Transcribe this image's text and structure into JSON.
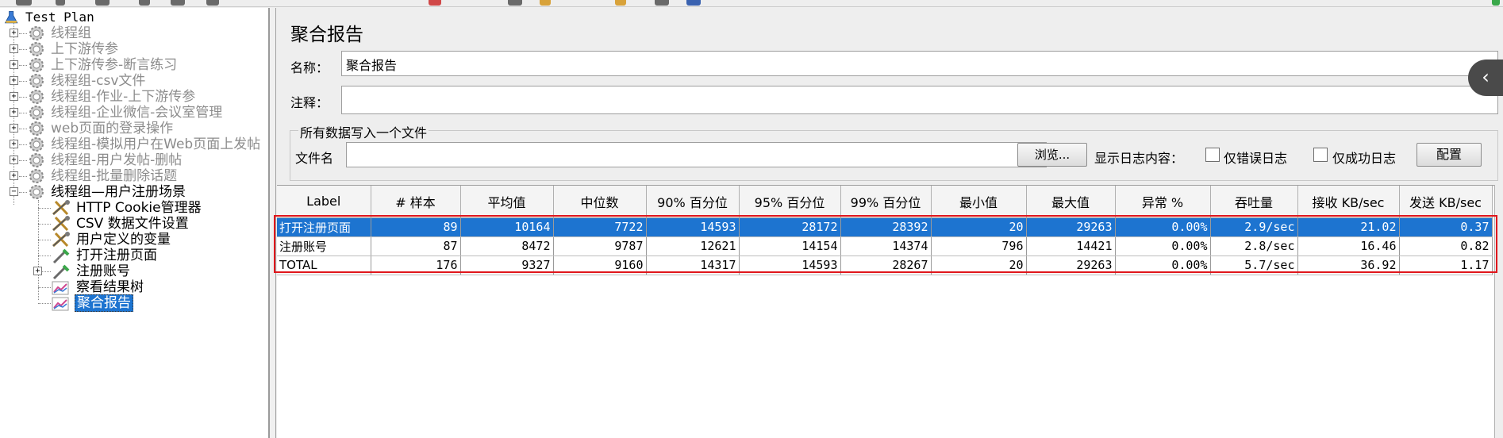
{
  "tree": {
    "root_label": "Test Plan",
    "items": [
      {
        "label": "线程组",
        "disabled": true
      },
      {
        "label": "上下游传参",
        "disabled": true
      },
      {
        "label": "上下游传参-断言练习",
        "disabled": true
      },
      {
        "label": "线程组-csv文件",
        "disabled": true
      },
      {
        "label": "线程组-作业-上下游传参",
        "disabled": true
      },
      {
        "label": "线程组-企业微信-会议室管理",
        "disabled": true
      },
      {
        "label": "web页面的登录操作",
        "disabled": true
      },
      {
        "label": "线程组-模拟用户在Web页面上发帖",
        "disabled": true
      },
      {
        "label": "线程组-用户发帖-删帖",
        "disabled": true
      },
      {
        "label": "线程组-批量删除话题",
        "disabled": true
      },
      {
        "label": "线程组—用户注册场景",
        "disabled": false
      }
    ],
    "children": [
      {
        "label": "HTTP Cookie管理器",
        "icon": "wrench-icon"
      },
      {
        "label": "CSV 数据文件设置",
        "icon": "wrench-icon"
      },
      {
        "label": "用户定义的变量",
        "icon": "wrench-icon"
      },
      {
        "label": "打开注册页面",
        "icon": "pipette-icon"
      },
      {
        "label": "注册账号",
        "icon": "pipette-icon"
      },
      {
        "label": "察看结果树",
        "icon": "chart-icon"
      },
      {
        "label": "聚合报告",
        "icon": "chart-icon",
        "selected": true
      }
    ]
  },
  "panel": {
    "title": "聚合报告",
    "name_label": "名称：",
    "name_value": "聚合报告",
    "comment_label": "注释：",
    "comment_value": "",
    "file_group_title": "所有数据写入一个文件",
    "filename_label": "文件名",
    "filename_value": "",
    "browse_button": "浏览...",
    "log_content_label": "显示日志内容：",
    "errors_only_label": "仅错误日志",
    "success_only_label": "仅成功日志",
    "configure_button": "配置"
  },
  "table": {
    "columns": [
      "Label",
      "# 样本",
      "平均值",
      "中位数",
      "90% 百分位",
      "95% 百分位",
      "99% 百分位",
      "最小值",
      "最大值",
      "异常 %",
      "吞吐量",
      "接收 KB/sec",
      "发送 KB/sec"
    ],
    "rows": [
      [
        "打开注册页面",
        "89",
        "10164",
        "7722",
        "14593",
        "28172",
        "28392",
        "20",
        "29263",
        "0.00%",
        "2.9/sec",
        "21.02",
        "0.37"
      ],
      [
        "注册账号",
        "87",
        "8472",
        "9787",
        "12621",
        "14154",
        "14374",
        "796",
        "14421",
        "0.00%",
        "2.8/sec",
        "16.46",
        "0.82"
      ],
      [
        "TOTAL",
        "176",
        "9327",
        "9160",
        "14317",
        "14593",
        "28267",
        "20",
        "29263",
        "0.00%",
        "5.7/sec",
        "36.92",
        "1.17"
      ]
    ],
    "selected_row": 0
  },
  "colors": {
    "selection": "#1d74d0",
    "highlight_box": "#e0161c",
    "disabled_text": "#8c8c8c"
  }
}
